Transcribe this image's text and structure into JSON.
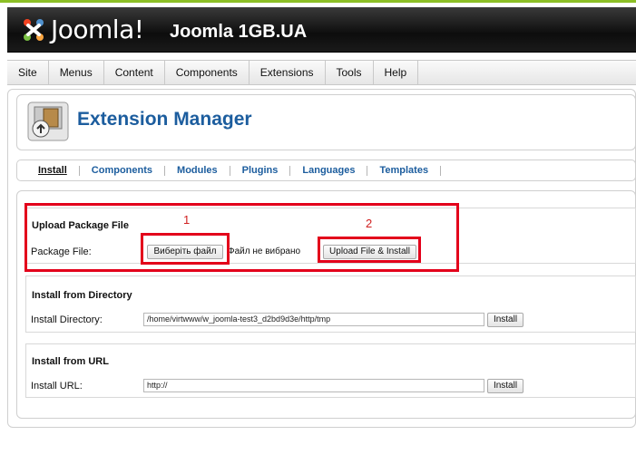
{
  "header": {
    "logo_text": "Joomla!",
    "site_title": "Joomla 1GB.UA"
  },
  "menu": [
    "Site",
    "Menus",
    "Content",
    "Components",
    "Extensions",
    "Tools",
    "Help"
  ],
  "page": {
    "title": "Extension Manager"
  },
  "subnav": [
    "Install",
    "Components",
    "Modules",
    "Plugins",
    "Languages",
    "Templates"
  ],
  "upload": {
    "title": "Upload Package File",
    "field_label": "Package File:",
    "choose_button": "Виберіть файл",
    "no_file_text": "Файл не вибрано",
    "submit_button": "Upload File & Install"
  },
  "directory": {
    "title": "Install from Directory",
    "field_label": "Install Directory:",
    "value": "/home/virtwww/w_joomla-test3_d2bd9d3e/http/tmp",
    "button": "Install"
  },
  "url": {
    "title": "Install from URL",
    "field_label": "Install URL:",
    "value": "http://",
    "button": "Install"
  },
  "annotations": {
    "first": "1",
    "second": "2"
  },
  "colors": {
    "accent_green": "#8cbf26",
    "title_blue": "#1c5d9e",
    "annotation_red": "#e3001b"
  }
}
